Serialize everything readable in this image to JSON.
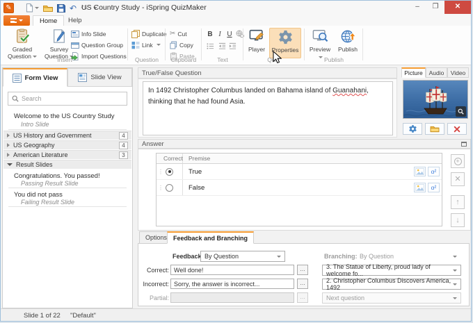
{
  "window": {
    "title": "US Country Study - iSpring QuizMaker",
    "controls": {
      "minimize": "–",
      "maximize": "❐",
      "close": "✕"
    }
  },
  "ribbon": {
    "tabs": [
      {
        "label": "Home",
        "active": true
      },
      {
        "label": "Help",
        "active": false
      }
    ],
    "insert": {
      "label": "Insert",
      "graded": "Graded Question",
      "survey": "Survey Question",
      "info_slide": "Info Slide",
      "question_group": "Question Group",
      "import_questions": "Import Questions"
    },
    "question": {
      "label": "Question",
      "duplicate": "Duplicate",
      "link": "Link"
    },
    "clipboard": {
      "label": "Clipboard",
      "cut": "Cut",
      "copy": "Copy",
      "paste": "Paste"
    },
    "text": {
      "label": "Text",
      "bold": "B",
      "italic": "I",
      "underline": "U"
    },
    "quiz": {
      "label": "Quiz",
      "player": "Player",
      "properties": "Properties",
      "properties_hovered": true
    },
    "publish": {
      "label": "Publish",
      "preview": "Preview",
      "publish": "Publish"
    }
  },
  "left_panel": {
    "tabs": [
      {
        "label": "Form View",
        "active": true
      },
      {
        "label": "Slide View",
        "active": false
      }
    ],
    "search_placeholder": "Search",
    "intro": {
      "title": "Welcome to the US Country Study",
      "subtitle": "Intro Slide"
    },
    "groups": [
      {
        "label": "US History and Government",
        "count": "4",
        "expanded": false
      },
      {
        "label": "US Geography",
        "count": "4",
        "expanded": false
      },
      {
        "label": "American Literature",
        "count": "3",
        "expanded": false
      },
      {
        "label": "Result Slides",
        "count": "",
        "expanded": true
      }
    ],
    "results": [
      {
        "title": "Congratulations. You passed!",
        "subtitle": "Passing Result Slide"
      },
      {
        "title": "You did not pass",
        "subtitle": "Failing Result Slide"
      }
    ]
  },
  "question_pane": {
    "header": "True/False Question",
    "text_before": "In 1492 Christopher Columbus landed on Bahama island of ",
    "text_marked": "Guanahani",
    "text_after": ", thinking that he had found Asia."
  },
  "media_pane": {
    "tabs": [
      {
        "label": "Picture",
        "active": true
      },
      {
        "label": "Audio",
        "active": false
      },
      {
        "label": "Video",
        "active": false
      }
    ]
  },
  "answer_pane": {
    "header": "Answer",
    "columns": {
      "correct": "Correct",
      "premise": "Premise"
    },
    "rows": [
      {
        "premise": "True",
        "selected": true
      },
      {
        "premise": "False",
        "selected": false
      }
    ],
    "buttons": {
      "add": "+",
      "delete": "✕",
      "up": "↑",
      "down": "↓"
    }
  },
  "bottom_pane": {
    "tabs": [
      {
        "label": "Options",
        "active": false
      },
      {
        "label": "Feedback and Branching",
        "active": true
      }
    ],
    "feedback": {
      "label": "Feedback:",
      "mode": "By Question",
      "rows": [
        {
          "label": "Correct:",
          "value": "Well done!",
          "disabled": false
        },
        {
          "label": "Incorrect:",
          "value": "Sorry, the answer is incorrect...",
          "disabled": false
        },
        {
          "label": "Partial:",
          "value": "",
          "disabled": true
        }
      ]
    },
    "branching": {
      "label": "Branching:",
      "mode": "By Question",
      "disabled": true,
      "options": [
        {
          "value": "3. The Statue of Liberty, proud lady of welcome fo...",
          "disabled": false
        },
        {
          "value": "2. Christopher Columbus Discovers America, 1492",
          "disabled": false
        },
        {
          "value": "Next question",
          "disabled": true
        }
      ]
    },
    "more_label": "..."
  },
  "status_bar": {
    "slide_info": "Slide 1 of 22",
    "player_name": "\"Default\""
  },
  "icons": {
    "drag_handle": "⋮",
    "equation": "α²",
    "undo": "↶",
    "redo": "↷",
    "cut": "✂"
  },
  "colors": {
    "accent": "#E8650F",
    "tab_accent": "#F59B31",
    "hover": "#FBDFB9"
  }
}
